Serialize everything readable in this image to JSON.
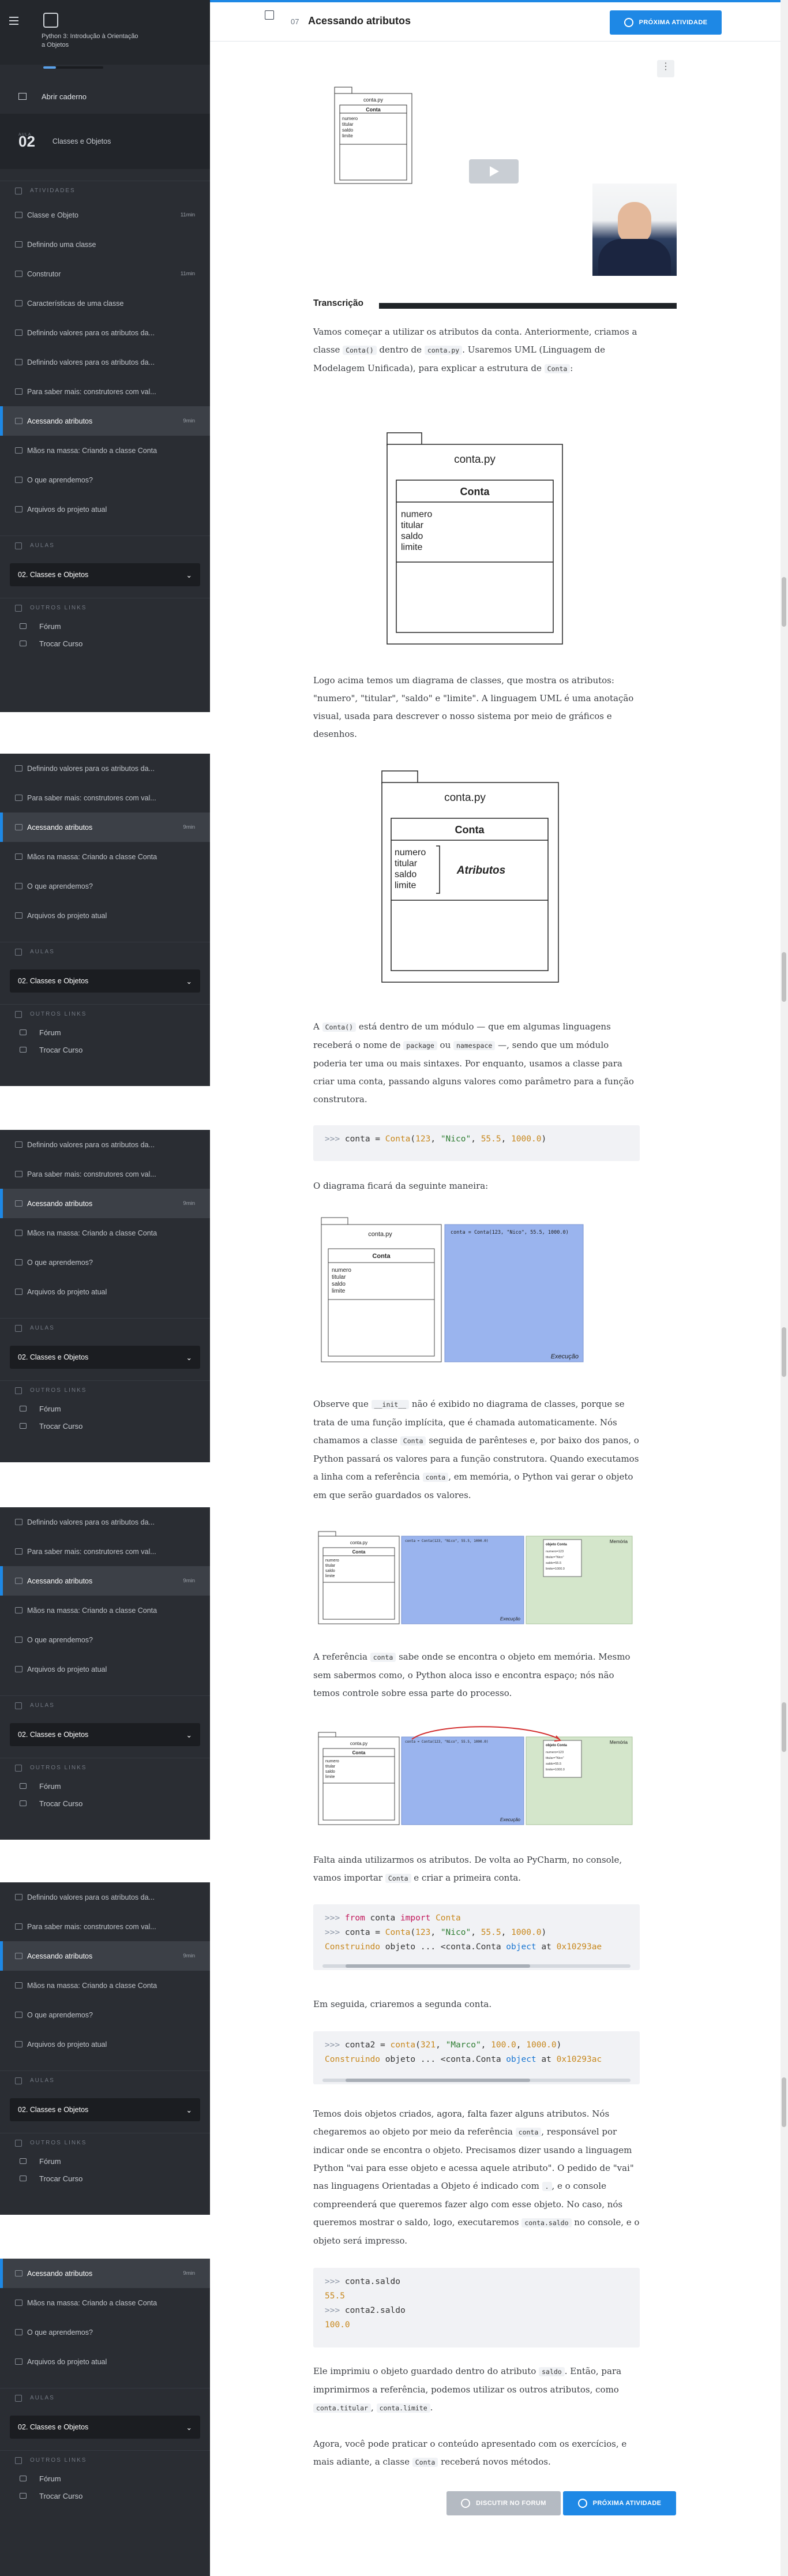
{
  "course": {
    "title_line1": "Python 3: Introdução à Orientação",
    "title_line2": "a Objetos",
    "notebook_label": "Abrir caderno",
    "chapter_caption": "AULA",
    "chapter_number": "02",
    "chapter_name": "Classes e Objetos"
  },
  "sidebar": {
    "activities_label": "ATIVIDADES",
    "aulas_label": "AULAS",
    "outros_label": "OUTROS LINKS",
    "select_value": "02. Classes e Objetos",
    "forum_label": "Fórum",
    "trocar_label": "Trocar Curso",
    "items": [
      {
        "label": "Classe e Objeto",
        "time": "11min"
      },
      {
        "label": "Definindo uma classe",
        "time": ""
      },
      {
        "label": "Construtor",
        "time": "11min"
      },
      {
        "label": "Características de uma classe",
        "time": ""
      },
      {
        "label": "Definindo valores para os atributos da...",
        "time": ""
      },
      {
        "label": "Definindo valores para os atributos da...",
        "time": ""
      },
      {
        "label": "Para saber mais: construtores com val...",
        "time": ""
      },
      {
        "label": "Acessando atributos",
        "time": "9min"
      },
      {
        "label": "Mãos na massa: Criando a classe Conta",
        "time": ""
      },
      {
        "label": "O que aprendemos?",
        "time": ""
      },
      {
        "label": "Arquivos do projeto atual",
        "time": ""
      }
    ]
  },
  "header": {
    "lesson_number": "07",
    "lesson_title": "Acessando atributos",
    "next_button": "PRÓXIMA ATIVIDADE"
  },
  "video": {
    "options_icon": "⋮"
  },
  "transcript": {
    "heading": "Transcrição",
    "p1_a": "Vamos começar a utilizar os atributos da conta. Anteriormente, criamos a classe ",
    "p1_code1": "Conta()",
    "p1_b": " dentro de ",
    "p1_code2": "conta.py",
    "p1_c": ". Usaremos UML (Linguagem de Modelagem Unificada), para explicar a estrutura de ",
    "p1_code3": "Conta",
    "p1_d": ":",
    "p2": "Logo acima temos um diagrama de classes, que mostra os atributos: \"numero\", \"titular\", \"saldo\" e \"limite\". A linguagem UML é uma anotação visual, usada para descrever o nosso sistema por meio de gráficos e desenhos.",
    "p3_a": "A ",
    "p3_code1": "Conta()",
    "p3_b": " está dentro de um módulo — que em algumas linguagens receberá o nome de ",
    "p3_code2": "package",
    "p3_c": " ou ",
    "p3_code3": "namespace",
    "p3_d": " —, sendo que um módulo poderia ter uma ou mais sintaxes. Por enquanto, usamos a classe para criar uma conta, passando alguns valores como parâmetro para a função construtora.",
    "p4": "O diagrama ficará da seguinte maneira:",
    "p5_a": "Observe que ",
    "p5_code1": "__init__",
    "p5_b": " não é exibido no diagrama de classes, porque se trata de uma função implícita, que é chamada automaticamente. Nós chamamos a classe ",
    "p5_code2": "Conta",
    "p5_c": " seguida de parênteses e, por baixo dos panos, o Python passará os valores para a função construtora. Quando executamos a linha com a referência ",
    "p5_code3": "conta",
    "p5_d": ", em memória, o Python vai gerar o objeto em que serão guardados os valores.",
    "p6_a": "A referência ",
    "p6_code1": "conta",
    "p6_b": " sabe onde se encontra o objeto em memória. Mesmo sem sabermos como, o Python aloca isso e encontra espaço; nós não temos controle sobre essa parte do processo.",
    "p7_a": "Falta ainda utilizarmos os atributos. De volta ao PyCharm, no console, vamos importar ",
    "p7_code1": "Conta",
    "p7_b": " e criar a primeira conta.",
    "p8": "Em seguida, criaremos a segunda conta.",
    "p9_a": "Temos dois objetos criados, agora, falta fazer alguns atributos. Nós chegaremos ao objeto por meio da referência ",
    "p9_code1": "conta",
    "p9_b": ", responsável por indicar onde se encontra o objeto. Precisamos dizer usando a linguagem Python \"vai para esse objeto e acessa aquele atributo\". O pedido de \"vai\" nas linguagens Orientadas a Objeto é indicado com ",
    "p9_code2": ".",
    "p9_c": ", e o console compreenderá que queremos fazer algo com esse objeto. No caso, nós queremos mostrar o saldo, logo, executaremos ",
    "p9_code3": "conta.saldo",
    "p9_d": " no console, e o objeto será impresso.",
    "p10_a": "Ele imprimiu o objeto guardado dentro do atributo ",
    "p10_code1": "saldo",
    "p10_b": ". Então, para imprimirmos a referência, podemos utilizar os outros atributos, como ",
    "p10_code2": "conta.titular",
    "p10_c": ", ",
    "p10_code3": "conta.limite",
    "p10_d": ".",
    "p11_a": "Agora, você pode praticar o conteúdo apresentado com os exercícios, e mais adiante, a classe ",
    "p11_code1": "Conta",
    "p11_b": " receberá novos métodos."
  },
  "uml": {
    "file": "conta.py",
    "class_name": "Conta",
    "attributes": [
      "numero",
      "titular",
      "saldo",
      "limite"
    ],
    "attributes_label": "Atributos",
    "exec_label": "Execução",
    "memory_label": "Memória",
    "exec_code": "conta = Conta(123, \"Nico\", 55.5, 1000.0)",
    "obj_title": "objeto Conta",
    "obj_lines": [
      "numero=123",
      "titular=\"Nico\"",
      "saldo=55.5",
      "limite=1000.0"
    ]
  },
  "code": {
    "c1": {
      "prompt": ">>> ",
      "a": "conta = ",
      "fn": "Conta",
      "b": "(",
      "n1": "123",
      "c": ", ",
      "s1": "\"Nico\"",
      "d": ", ",
      "n2": "55.5",
      "e": ", ",
      "n3": "1000.0",
      "f": ")"
    },
    "c2": {
      "l1_prompt": ">>> ",
      "l1_kw1": "from",
      "l1_a": " conta ",
      "l1_kw2": "import",
      "l1_fn": " Conta",
      "l2_prompt": ">>> ",
      "l2_a": "conta = ",
      "l2_fn": "Conta",
      "l2_b": "(",
      "l2_n1": "123",
      "l2_c": ", ",
      "l2_s1": "\"Nico\"",
      "l2_d": ", ",
      "l2_n2": "55.5",
      "l2_e": ", ",
      "l2_n3": "1000.0",
      "l2_f": ")",
      "l3_a": "Construindo",
      "l3_b": " objeto ... <conta.Conta ",
      "l3_kw": "object",
      "l3_c": " at ",
      "l3_addr": "0x10293ae"
    },
    "c3": {
      "l1_prompt": ">>> ",
      "l1_a": "conta2 = ",
      "l1_fn": "conta",
      "l1_b": "(",
      "l1_n1": "321",
      "l1_c": ", ",
      "l1_s1": "\"Marco\"",
      "l1_d": ", ",
      "l1_n2": "100.0",
      "l1_e": ", ",
      "l1_n3": "1000.0",
      "l1_f": ")",
      "l2_a": "Construindo",
      "l2_b": " objeto ... <conta.Conta ",
      "l2_kw": "object",
      "l2_c": " at ",
      "l2_addr": "0x10293ac"
    },
    "c4": {
      "l1_prompt": ">>> ",
      "l1": "conta.saldo",
      "l2": "55.5",
      "l3_prompt": ">>> ",
      "l3": "conta2.saldo",
      "l4": "100.0"
    }
  },
  "footer": {
    "forum_button": "DISCUTIR NO FORUM",
    "next_button": "PRÓXIMA ATIVIDADE"
  },
  "colors": {
    "accent": "#1e88e5",
    "sidebar": "#2a2d33",
    "exec_panel": "#9ab4ee",
    "memory_panel": "#d4e6cb"
  }
}
